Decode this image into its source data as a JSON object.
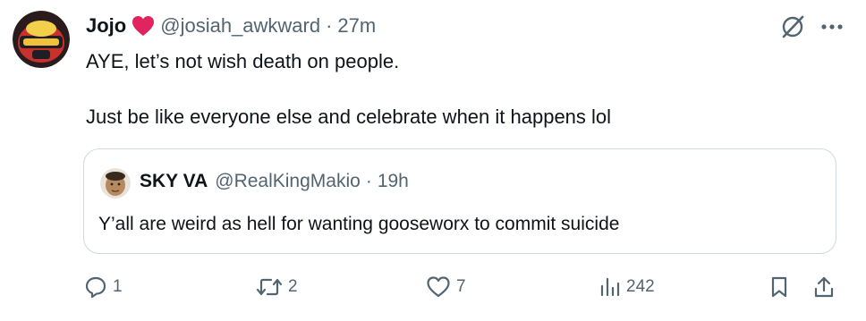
{
  "tweet": {
    "display_name": "Jojo",
    "handle": "@josiah_awkward",
    "separator": "·",
    "time": "27m",
    "text_line1": "AYE, let’s not wish death on people.",
    "text_line2": "Just be like everyone else and celebrate when it happens lol"
  },
  "quoted": {
    "display_name": "SKY VA",
    "handle": "@RealKingMakio",
    "separator": "·",
    "time": "19h",
    "text": "Y’all are weird as hell for wanting gooseworx to commit suicide"
  },
  "actions": {
    "replies": "1",
    "reposts": "2",
    "likes": "7",
    "views": "242"
  },
  "icons": {
    "heart": "heart-emoji-icon",
    "grok": "grok-icon",
    "more": "more-icon",
    "reply": "reply-icon",
    "repost": "repost-icon",
    "like": "like-icon",
    "views": "views-icon",
    "bookmark": "bookmark-icon",
    "share": "share-icon"
  },
  "colors": {
    "text": "#0f1419",
    "muted": "#536471",
    "border": "#cfd9de",
    "heart": "#e0245e"
  }
}
